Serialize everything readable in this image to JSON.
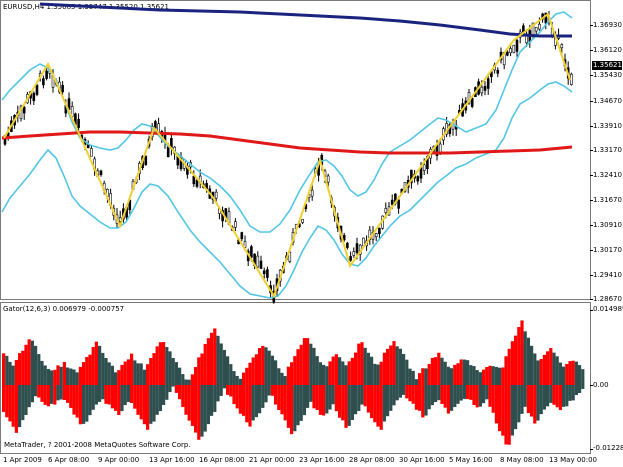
{
  "main_chart": {
    "header": "EURUSD,H4  1.35685 1.35747 1.35520 1.35621",
    "current_price": "1.35621",
    "price_scale": [
      "1.36930",
      "1.36120",
      "1.35430",
      "1.34670",
      "1.33910",
      "1.33170",
      "1.32410",
      "1.31670",
      "1.30910",
      "1.30170",
      "1.29410",
      "1.28670"
    ],
    "colors": {
      "candles": "#000000",
      "upper_lower_band": "#53c6e6",
      "zigzag": "#f0d030",
      "ma_red": "#e01818",
      "ma_navy": "#1a237e"
    }
  },
  "indicator": {
    "header": "Gator(12,6,3) 0.006979 -0.000757",
    "scale": [
      "0.014989",
      "0.00",
      "-0.01228"
    ],
    "colors": {
      "up": "#ff0000",
      "down": "#2f4f4f"
    }
  },
  "copyright": "MetaTrader, ? 2001-2008 MetaQuotes Software Corp.",
  "time_axis": [
    "1 Apr 2009",
    "6 Apr 08:00",
    "9 Apr 00:00",
    "13 Apr 16:00",
    "16 Apr 08:00",
    "21 Apr 00:00",
    "23 Apr 16:00",
    "28 Apr 08:00",
    "30 Apr 16:00",
    "5 May 16:00",
    "8 May 08:00",
    "13 May 00:00"
  ]
}
